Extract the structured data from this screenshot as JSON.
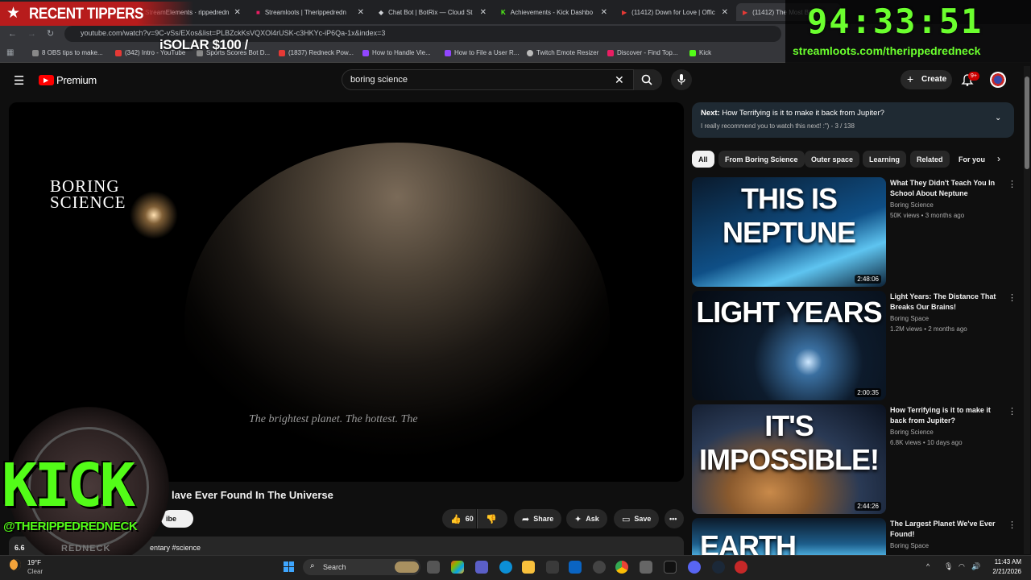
{
  "overlay": {
    "recent_tippers": "RECENT TIPPERS",
    "ticker": "iSOLAR $100 /",
    "timer": "94:33:51",
    "stream_url": "streamloots.com/therippedredneck",
    "kick_logo": "KICK",
    "kick_handle": "@THERIPPEDREDNECK",
    "kick_sub": "REDNECK"
  },
  "browser": {
    "tabs": [
      {
        "label": "StreamElements · rippedredn"
      },
      {
        "label": "Streamloots | Therippedredn"
      },
      {
        "label": "Chat Bot | BotRix — Cloud St"
      },
      {
        "label": "Achievements - Kick Dashbo"
      },
      {
        "label": "(11412) Down for Love | Offic"
      },
      {
        "label": "(11412) The Most Bi"
      }
    ],
    "url": "youtube.com/watch?v=9C-vSs/EXos&list=PLBZckKsVQXOl4rUSK-c3HKYc-iP6Qa-1x&index=3",
    "bookmarks": [
      {
        "label": "8 OBS tips to make...",
        "color": "#888"
      },
      {
        "label": "(342) Intro - YouTube",
        "color": "#e53935"
      },
      {
        "label": "Sports Scores Bot D...",
        "color": "#888"
      },
      {
        "label": "(1837) Redneck Pow...",
        "color": "#e53935"
      },
      {
        "label": "How to Handle Vie...",
        "color": "#9146ff"
      },
      {
        "label": "How to File a User R...",
        "color": "#9146ff"
      },
      {
        "label": "Twitch Emote Resizer",
        "color": "#bbb"
      },
      {
        "label": "Discover - Find Top...",
        "color": "#e91e63"
      },
      {
        "label": "Kick",
        "color": "#53fc18"
      }
    ]
  },
  "youtube": {
    "logo": "Premium",
    "search_value": "boring science",
    "create_label": "Create",
    "notif_badge": "9+",
    "player": {
      "brand_line1": "BORING",
      "brand_line2": "SCIENCE",
      "caption": "The brightest planet. The hottest. The"
    },
    "video_title": "lave Ever Found In The Universe",
    "subscribe": "ibe",
    "likes": "60",
    "share": "Share",
    "ask": "Ask",
    "save": "Save",
    "views_partial": "6.6",
    "desc_partial": "entary #science",
    "next": {
      "label": "Next:",
      "title": "How Terrifying is it to make it back from Jupiter?",
      "sub": "I really recommend you to watch this next! :\") - 3 / 138"
    },
    "chips": [
      "All",
      "From Boring Science",
      "Outer space",
      "Learning",
      "Related",
      "For you"
    ],
    "recommendations": [
      {
        "thumb_text": "THIS IS NEPTUNE",
        "duration": "2:48:06",
        "title": "What They Didn't Teach You In School About Neptune",
        "channel": "Boring Science",
        "meta": "50K views • 3 months ago"
      },
      {
        "thumb_text": "LIGHT YEARS",
        "duration": "2:00:35",
        "title": "Light Years: The Distance That Breaks Our Brains!",
        "channel": "Boring Space",
        "meta": "1.2M views • 2 months ago"
      },
      {
        "thumb_text": "IT'S IMPOSSIBLE!",
        "duration": "2:44:26",
        "title": "How Terrifying is it to make it back from Jupiter?",
        "channel": "Boring Science",
        "meta": "6.8K views • 10 days ago"
      },
      {
        "thumb_text": "EARTH",
        "duration": "",
        "title": "The Largest Planet We've Ever Found!",
        "channel": "Boring Space",
        "meta": ""
      }
    ]
  },
  "taskbar": {
    "weather_temp": "19°F",
    "weather_desc": "Clear",
    "search": "Search",
    "time": "11:43 AM",
    "date": "2/21/2026"
  }
}
